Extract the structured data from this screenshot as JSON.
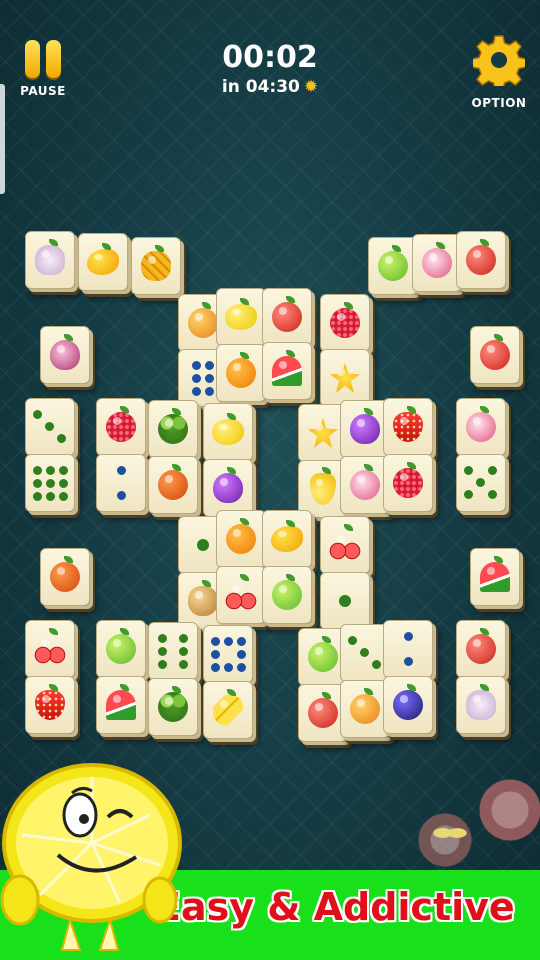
{
  "header": {
    "pause_label": "PAUSE",
    "option_label": "OPTION",
    "elapsed": "00:02",
    "target": "in 04:30",
    "pause_icon": "pause-icon",
    "option_icon": "gear-icon",
    "target_icon": "sun-icon"
  },
  "colors": {
    "background": "#143a42",
    "tile_face": "#f6efd2",
    "button_yellow": "#f7c21a",
    "banner_green": "#18e11b",
    "banner_text": "#e0101a"
  },
  "board": {
    "tiles": [
      {
        "face": "garlic"
      },
      {
        "face": "mango"
      },
      {
        "face": "pineapple"
      },
      {
        "face": "green-apple"
      },
      {
        "face": "turnip"
      },
      {
        "face": "mixed-fruit"
      },
      {
        "face": "apricot"
      },
      {
        "face": "lemon"
      },
      {
        "face": "apple-half"
      },
      {
        "face": "raspberry"
      },
      {
        "face": "onion"
      },
      {
        "face": "dots-6-blue"
      },
      {
        "face": "orange"
      },
      {
        "face": "watermelon"
      },
      {
        "face": "starfruit"
      },
      {
        "face": "red-apple"
      },
      {
        "face": "dots-3-green"
      },
      {
        "face": "raspberry"
      },
      {
        "face": "broccoli"
      },
      {
        "face": "lemon"
      },
      {
        "face": "starfruit"
      },
      {
        "face": "eggplant"
      },
      {
        "face": "strawberry"
      },
      {
        "face": "turnip"
      },
      {
        "face": "dots-9-green"
      },
      {
        "face": "dots-2-blue"
      },
      {
        "face": "persimmon"
      },
      {
        "face": "eggplant"
      },
      {
        "face": "pear"
      },
      {
        "face": "turnip"
      },
      {
        "face": "raspberry"
      },
      {
        "face": "dots-5-green"
      },
      {
        "face": "dots-1-green"
      },
      {
        "face": "orange"
      },
      {
        "face": "mango"
      },
      {
        "face": "cherries"
      },
      {
        "face": "persimmon"
      },
      {
        "face": "watermelon"
      },
      {
        "face": "nuts"
      },
      {
        "face": "cherries"
      },
      {
        "face": "green-apple"
      },
      {
        "face": "dots-1-green"
      },
      {
        "face": "cherries"
      },
      {
        "face": "green-apple"
      },
      {
        "face": "dots-6-green"
      },
      {
        "face": "dots-8-blue"
      },
      {
        "face": "green-apple"
      },
      {
        "face": "dots-3-green"
      },
      {
        "face": "dots-2-blue"
      },
      {
        "face": "red-apple"
      },
      {
        "face": "strawberry"
      },
      {
        "face": "watermelon"
      },
      {
        "face": "broccoli"
      },
      {
        "face": "bananas"
      },
      {
        "face": "red-apple"
      },
      {
        "face": "apricot"
      },
      {
        "face": "plums"
      },
      {
        "face": "garlic"
      }
    ]
  },
  "promo": {
    "banner_text": "Easy & Addictive",
    "mascot": "winking-lemon-mascot"
  }
}
